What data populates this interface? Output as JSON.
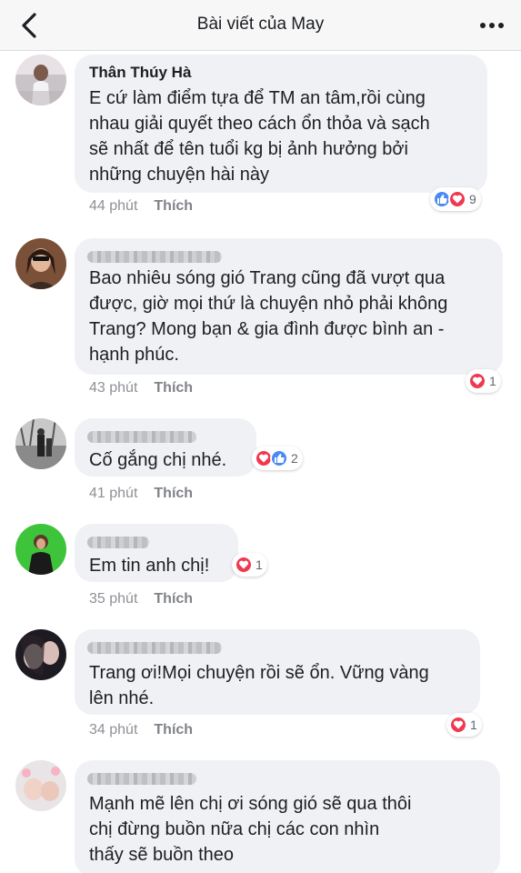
{
  "header": {
    "title": "Bài viết của May"
  },
  "comments": [
    {
      "author": "Thân Thúy Hà",
      "lines": [
        "E cứ làm điểm tựa để TM an tâm,rồi cùng",
        "nhau giải quyết theo cách ổn thỏa và sạch",
        "sẽ nhất để tên tuổi kg bị ảnh hưởng bởi",
        "những chuyện hài này"
      ],
      "time": "44 phút",
      "like_label": "Thích",
      "reactions": [
        "like",
        "love"
      ],
      "reaction_count": "9"
    },
    {
      "author": "",
      "lines": [
        "Bao nhiêu sóng gió Trang cũng đã vượt qua",
        "được, giờ mọi thứ là chuyện nhỏ phải không",
        "Trang? Mong bạn & gia đình được bình an -",
        "hạnh phúc."
      ],
      "time": "43 phút",
      "like_label": "Thích",
      "reactions": [
        "love"
      ],
      "reaction_count": "1"
    },
    {
      "author": "",
      "lines": [
        "Cố gắng chị nhé."
      ],
      "time": "41 phút",
      "like_label": "Thích",
      "reactions": [
        "love",
        "like"
      ],
      "reaction_count": "2"
    },
    {
      "author": "",
      "lines": [
        "Em tin anh chị!"
      ],
      "time": "35 phút",
      "like_label": "Thích",
      "reactions": [
        "love"
      ],
      "reaction_count": "1"
    },
    {
      "author": "",
      "lines": [
        "Trang ơi!Mọi chuyện rồi sẽ ổn. Vững vàng",
        "lên nhé."
      ],
      "time": "34 phút",
      "like_label": "Thích",
      "reactions": [
        "love"
      ],
      "reaction_count": "1"
    },
    {
      "author": "",
      "lines": [
        "Mạnh mẽ lên chị ơi sóng gió sẽ qua thôi",
        "chị đừng buồn nữa chị các con nhìn",
        "thấy sẽ buồn theo"
      ]
    }
  ],
  "colors": {
    "like_blue": "#4a8af4",
    "love_red": "#f0384f",
    "bubble_gray": "#f0f1f5"
  }
}
